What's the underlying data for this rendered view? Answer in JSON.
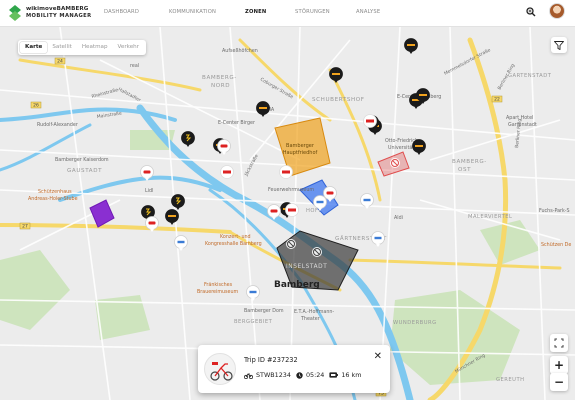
{
  "brand": {
    "line1": "wikimoveBAMBERG",
    "line2": "MOBILITY MANAGER"
  },
  "nav": [
    {
      "label": "DASHBOARD"
    },
    {
      "label": "KOMMUNIKATION"
    },
    {
      "label": "ZONEN"
    },
    {
      "label": "STÖRUNGEN"
    },
    {
      "label": "ANALYSE"
    }
  ],
  "map_tabs": [
    {
      "label": "Karte"
    },
    {
      "label": "Satellit"
    },
    {
      "label": "Heatmap"
    },
    {
      "label": "Verkehr"
    }
  ],
  "map_labels": {
    "aufsessholen": "Aufseßhöfchen",
    "bamberg_nord": "BAMBERG-",
    "bamberg_nord2": "NORD",
    "gartenstadt": "GARTENSTADT",
    "schubertshof": "SCHUBERTSHOF",
    "ecenter": "E-Center Bamberg",
    "norma": "NORMA",
    "ecenter_birger": "E-Center Birger",
    "apart_hotel": "Apart Hotel",
    "apart_hotel2": "Gartenstadt",
    "rudolf": "Rudolf-Alexander",
    "otto": "Otto-Friedrich-",
    "otto2": "Universität Ba",
    "bamberg_kaiserdom": "Bamberger Kaiserdom",
    "gaustadt": "GAUSTADT",
    "bamberg_ost": "BAMBERG-",
    "bamberg_ost2": "OST",
    "hauptfriedhof": "Bamberger",
    "hauptfriedhof2": "Hauptfriedhof",
    "lidl": "Lidl",
    "schuetzenhaus": "Schützenhaus",
    "schuetzenhaus2": "Andreas-Holer-Stube",
    "feuerwehr": "Feuerwehrmuseum",
    "hoff": "HOFF",
    "aldi": "Aldi",
    "malerviertel": "MALERVIERTEL",
    "fuchs": "Fuchs-Park-S",
    "schuetzen_de": "Schützen De",
    "gaertnerstadt": "GÄRTNERSTADT",
    "konzert": "Konzert- und",
    "konzert2": "Kongresshalle Bamberg",
    "inselstadt": "INSELSTADT",
    "bamberg": "Bamberg",
    "fraenkisches": "Fränkisches",
    "fraenkisches2": "Brauereimuseum",
    "bergebiet": "BERGGEBIET",
    "bamberger_dom": "Bamberger Dom",
    "eta": "E.T.A.-Hoffmann-",
    "eta2": "Theater",
    "wunderburg": "WUNDERBURG",
    "gereuth": "GEREUTH",
    "bahnhof": "Bamberg",
    "road_real": "real",
    "road_berliner": "Berliner Ring",
    "road_memmel": "Memmelsdorfer Straße",
    "road_coburger": "Coburger Straße",
    "road_hallstadter": "Hallstadter",
    "road_rhein": "Rheinstraße",
    "road_main": "Mainstraße",
    "road_starken": "Starkenfeldstraße",
    "road_jaeck": "Jäckstraße",
    "road_wilhelm": "Wilhelmsplatz",
    "road_muench": "Münchner Ring",
    "road_armee": "Armeestraße",
    "road_ludwig": "Ludwigstraße",
    "road_neben": "Nebenstraße",
    "road_24": "24",
    "road_26": "26",
    "road_27": "27",
    "road_22": "22",
    "road_73": "73"
  },
  "trip": {
    "title": "Trip ID #237232",
    "vehicle": "STWB1234",
    "duration": "05:24",
    "distance": "16 km",
    "close": "✕"
  },
  "zoom": {
    "in": "+",
    "out": "−"
  },
  "colors": {
    "accent": "#2fa64b",
    "zone_orange": "#f0a21e",
    "zone_purple": "#8a2fd1",
    "zone_blue": "#4a7ef0",
    "zone_red": "#e04e4e",
    "zone_gray": "#3a3a3a",
    "water": "#7ec8ef",
    "road_yellow": "#f6d86a"
  },
  "icons": [
    "search-icon",
    "avatar",
    "filter-icon",
    "fullscreen-icon",
    "scooter-icon",
    "bike-icon",
    "car-icon",
    "close-icon",
    "clock-icon",
    "battery-icon"
  ]
}
